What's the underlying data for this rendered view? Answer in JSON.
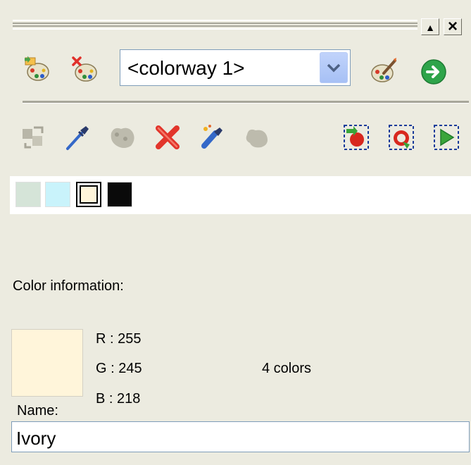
{
  "window": {
    "minimize_glyph": "▲",
    "close_glyph": "×"
  },
  "toolbar": {
    "colorway_select": {
      "value": "<colorway 1>"
    },
    "icons": [
      "add-palette-icon",
      "delete-palette-icon",
      "chevron-down-icon",
      "paint-palette-icon",
      "go-arrow-icon"
    ]
  },
  "tools": {
    "icons": [
      "replace-color-icon",
      "eyedropper-icon",
      "gray-tool-icon",
      "delete-color-icon",
      "brush-tool-icon",
      "blob-tool-icon",
      "record-icon",
      "loop-icon",
      "play-icon"
    ]
  },
  "swatches": [
    {
      "name": "light-sage",
      "color": "#d5e4d8"
    },
    {
      "name": "light-cyan",
      "color": "#c9f3fb"
    },
    {
      "name": "ivory",
      "color": "#fff5da",
      "selected": true
    },
    {
      "name": "black",
      "color": "#0a0a0a"
    }
  ],
  "color_info": {
    "heading": "Color information:",
    "preview_color": "#fff5da",
    "r": "R : 255",
    "g": "G : 245",
    "b": "B : 218",
    "count": "4 colors",
    "name_label": "Name:",
    "name_value": "Ivory"
  }
}
